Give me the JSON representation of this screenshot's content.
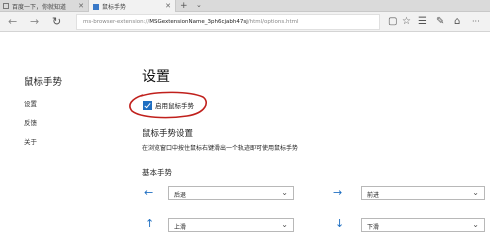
{
  "tabs": [
    {
      "title": "百度一下，你就知道"
    },
    {
      "title": "鼠标手势"
    }
  ],
  "tab_close": "✕",
  "new_tab": "+",
  "tab_menu": "⌄",
  "nav": {
    "back": "←",
    "forward": "→",
    "refresh": "↻"
  },
  "address": {
    "prefix": "ms-browser-extension://",
    "highlight": "MSGextensionName_3ph6cjabh47sj",
    "suffix": "/html/options.html"
  },
  "toolbar": {
    "reading_view": "▢",
    "favorite": "☆",
    "hub": "☰",
    "notes": "✎",
    "share": "⌂",
    "more": "···"
  },
  "sidebar": {
    "title": "鼠标手势",
    "items": [
      {
        "label": "设置"
      },
      {
        "label": "反馈"
      },
      {
        "label": "关于"
      }
    ]
  },
  "main": {
    "title": "设置",
    "enable_checkbox": {
      "label": "启用鼠标手势",
      "checked": true
    },
    "section_title": "鼠标手势设置",
    "section_desc": "在浏览窗口中按住鼠标右键滑出一个轨迹即可使用鼠标手势",
    "basic_title": "基本手势",
    "gestures": [
      {
        "arrow": "←",
        "action": "后退"
      },
      {
        "arrow": "→",
        "action": "前进"
      },
      {
        "arrow": "↑",
        "action": "上滑"
      },
      {
        "arrow": "↓",
        "action": "下滑"
      }
    ]
  },
  "colors": {
    "accent": "#1f6fc2",
    "annotation": "#c0201c"
  }
}
